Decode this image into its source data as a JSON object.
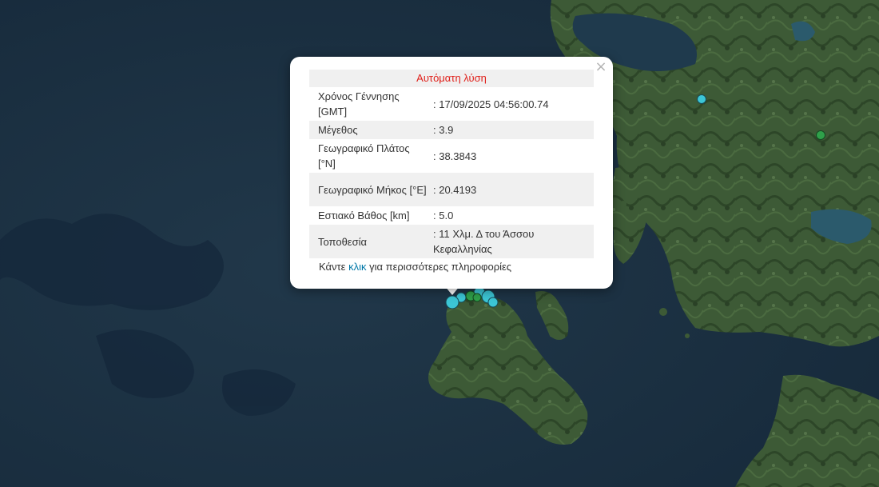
{
  "popup": {
    "title": "Αυτόματη λύση",
    "close_label": "×",
    "rows": [
      {
        "label": "Χρόνος Γέννησης [GMT]",
        "value": ": 17/09/2025 04:56:00.74"
      },
      {
        "label": "Μέγεθος",
        "value": ": 3.9"
      },
      {
        "label": "Γεωγραφικό Πλάτος [°N]",
        "value": ": 38.3843"
      },
      {
        "label": "Γεωγραφικό Μήκος [°E]",
        "value": ": 20.4193"
      },
      {
        "label": "Εστιακό Βάθος [km]",
        "value": ": 5.0"
      },
      {
        "label": "Τοποθεσία",
        "value": ": 11 Χλμ. Δ του Άσσου Κεφαλληνίας"
      }
    ],
    "more_prefix": "Κάντε ",
    "more_link": "κλικ",
    "more_suffix": " για περισσότερες πληροφορίες"
  },
  "colors": {
    "sea": "#1b2f3f",
    "land": "#3b5734",
    "land_dark": "#2c4427",
    "marker_cyan": "#3cc6d6",
    "marker_green": "#2fa04a",
    "title_red": "#e0201a",
    "link_blue": "#0078a8"
  }
}
